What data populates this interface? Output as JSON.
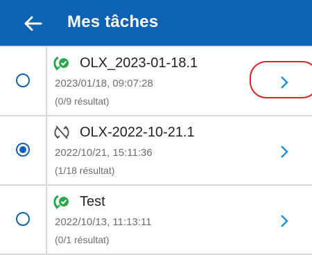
{
  "app_bar": {
    "title": "Mes tâches",
    "back_icon": "arrow-left-icon",
    "background": "#0d62b4"
  },
  "tasks": [
    {
      "name": "OLX_2023-01-18.1",
      "date": "2023/01/18, 09:07:28",
      "result": "(0/9 résultat)",
      "selected": false,
      "status_icon": "sync-check-icon"
    },
    {
      "name": "OLX-2022-10-21.1",
      "date": "2022/10/21, 15:11:36",
      "result": "(1/18 résultat)",
      "selected": true,
      "status_icon": "sync-disabled-icon"
    },
    {
      "name": "Test",
      "date": "2022/10/13, 11:13:11",
      "result": "(0/1 résultat)",
      "selected": false,
      "status_icon": "sync-check-icon"
    }
  ],
  "colors": {
    "accent": "#0d62b4",
    "status_green": "#2aa84a",
    "annotation_red": "#e02222"
  }
}
